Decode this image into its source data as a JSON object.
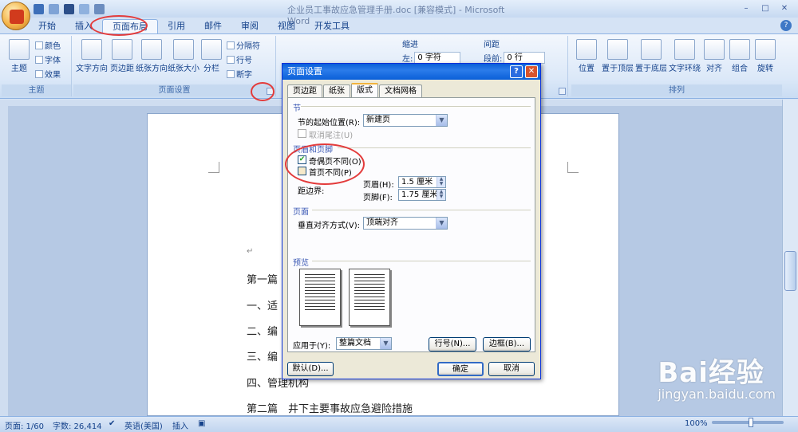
{
  "window": {
    "title": "企业员工事故应急管理手册.doc [兼容模式] - Microsoft Word"
  },
  "tabs": [
    "开始",
    "插入",
    "页面布局",
    "引用",
    "邮件",
    "审阅",
    "视图",
    "开发工具"
  ],
  "active_tab": "页面布局",
  "ribbon": {
    "theme_group": {
      "label": "主题",
      "themes": "主题",
      "colors": "颜色",
      "fonts": "字体",
      "effects": "效果"
    },
    "page_setup_group": {
      "label": "页面设置",
      "text_direction": "文字方向",
      "margins": "页边距",
      "orientation": "纸张方向",
      "size": "纸张大小",
      "columns": "分栏",
      "breaks": "分隔符",
      "line_numbers": "行号",
      "hyphenation": "断字"
    },
    "indent_group": {
      "label": "缩进",
      "left": "左:",
      "left_value": "0 字符"
    },
    "spacing_group": {
      "label": "间距",
      "before": "段前:",
      "before_value": "0 行"
    },
    "arrange_group": {
      "label": "排列",
      "position": "位置",
      "bring_front": "置于顶层",
      "send_back": "置于底层",
      "text_wrap": "文字环绕",
      "align": "对齐",
      "group": "组合",
      "rotate": "旋转"
    }
  },
  "document": {
    "lines": [
      "第一篇",
      "一、适",
      "二、编",
      "三、编",
      "四、管理机构",
      "第二篇　井下主要事故应急避险措施"
    ]
  },
  "dialog": {
    "title": "页面设置",
    "tabs": [
      "页边距",
      "纸张",
      "版式",
      "文档网格"
    ],
    "active_tab": "版式",
    "section": {
      "label": "节",
      "start_label": "节的起始位置(R):",
      "start_value": "新建页",
      "suppress_endnotes": "取消尾注(U)"
    },
    "header_footer": {
      "label": "页眉和页脚",
      "odd_even": "奇偶页不同(O)",
      "odd_even_checked": true,
      "first_page": "首页不同(P)",
      "first_page_checked": false,
      "from_edge": "距边界:",
      "header_label": "页眉(H):",
      "header_value": "1.5 厘米",
      "footer_label": "页脚(F):",
      "footer_value": "1.75 厘米"
    },
    "page": {
      "label": "页面",
      "valign_label": "垂直对齐方式(V):",
      "valign_value": "顶端对齐"
    },
    "preview": {
      "label": "预览",
      "apply_label": "应用于(Y):",
      "apply_value": "整篇文档",
      "line_numbers_button": "行号(N)...",
      "borders_button": "边框(B)..."
    },
    "buttons": {
      "default": "默认(D)...",
      "ok": "确定",
      "cancel": "取消"
    }
  },
  "status": {
    "page": "页面: 1/60",
    "words": "字数: 26,414",
    "language": "英语(美国)",
    "insert": "插入",
    "zoom": "100%"
  },
  "watermark": {
    "brand": "Bai经验",
    "url": "jingyan.baidu.com"
  }
}
